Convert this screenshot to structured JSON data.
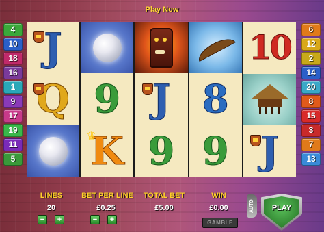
{
  "header": {
    "play_now": "Play Now"
  },
  "paylines_left": [
    {
      "n": "4",
      "color": "#3aa83a"
    },
    {
      "n": "10",
      "color": "#2a5fc8"
    },
    {
      "n": "18",
      "color": "#c02a6a"
    },
    {
      "n": "16",
      "color": "#7a3a9a"
    },
    {
      "n": "1",
      "color": "#2aa8b8"
    },
    {
      "n": "9",
      "color": "#8a3ab8"
    },
    {
      "n": "17",
      "color": "#c83a8a"
    },
    {
      "n": "19",
      "color": "#3ab84a"
    },
    {
      "n": "11",
      "color": "#7a2ab8"
    },
    {
      "n": "5",
      "color": "#3a9a3a"
    }
  ],
  "paylines_right": [
    {
      "n": "6",
      "color": "#e07a1a"
    },
    {
      "n": "12",
      "color": "#d8a81a"
    },
    {
      "n": "2",
      "color": "#c8a81a"
    },
    {
      "n": "14",
      "color": "#2a5fc8"
    },
    {
      "n": "20",
      "color": "#3aa8c8"
    },
    {
      "n": "8",
      "color": "#e05a1a"
    },
    {
      "n": "15",
      "color": "#d82a2a"
    },
    {
      "n": "3",
      "color": "#c82a2a"
    },
    {
      "n": "7",
      "color": "#e07a1a"
    },
    {
      "n": "13",
      "color": "#3a8ad8"
    }
  ],
  "reels": [
    [
      {
        "type": "letter",
        "text": "J",
        "style": "J",
        "badge": "shield"
      },
      {
        "type": "letter",
        "text": "Q",
        "style": "Q",
        "badge": "shield"
      },
      {
        "type": "pearl",
        "icon": "pearl-icon"
      }
    ],
    [
      {
        "type": "pearl",
        "icon": "pearl-icon"
      },
      {
        "type": "letter",
        "text": "9",
        "style": "9"
      },
      {
        "type": "letter",
        "text": "K",
        "style": "K",
        "badge": "crown"
      }
    ],
    [
      {
        "type": "tiki",
        "icon": "tiki-mask-icon"
      },
      {
        "type": "letter",
        "text": "J",
        "style": "J",
        "badge": "shield"
      },
      {
        "type": "letter",
        "text": "9",
        "style": "9"
      }
    ],
    [
      {
        "type": "canoe",
        "icon": "canoe-icon"
      },
      {
        "type": "letter",
        "text": "8",
        "style": "8"
      },
      {
        "type": "letter",
        "text": "9",
        "style": "9"
      }
    ],
    [
      {
        "type": "letter",
        "text": "10",
        "style": "10"
      },
      {
        "type": "hut",
        "icon": "hut-icon"
      },
      {
        "type": "letter",
        "text": "J",
        "style": "J",
        "badge": "shield"
      }
    ]
  ],
  "controls": {
    "lines_label": "LINES",
    "lines_value": "20",
    "bet_label": "BET PER LINE",
    "bet_value": "£0.25",
    "total_label": "TOTAL BET",
    "total_value": "£5.00",
    "win_label": "WIN",
    "win_value": "£0.00",
    "gamble_label": "GAMBLE",
    "minus": "−",
    "plus": "+",
    "auto_label": "AUTO",
    "play_label": "PLAY"
  }
}
